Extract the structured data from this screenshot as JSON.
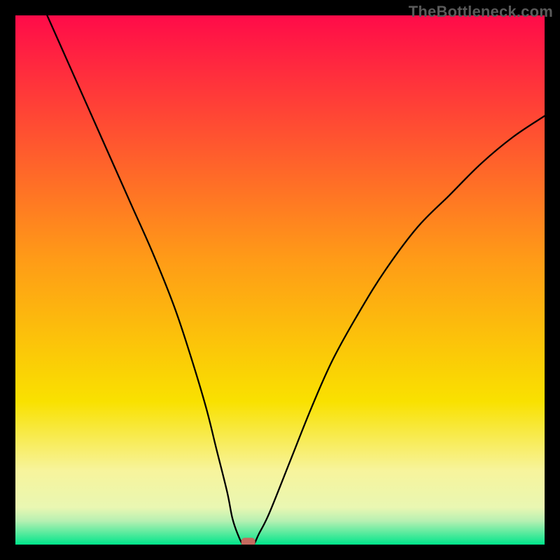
{
  "watermark": "TheBottleneck.com",
  "chart_data": {
    "type": "line",
    "title": "",
    "xlabel": "",
    "ylabel": "",
    "xlim": [
      0,
      100
    ],
    "ylim": [
      0,
      100
    ],
    "grid": false,
    "background_gradient": [
      {
        "stop": 0.0,
        "color": "#ff0b49"
      },
      {
        "stop": 0.46,
        "color": "#ff9b17"
      },
      {
        "stop": 0.73,
        "color": "#f9e100"
      },
      {
        "stop": 0.86,
        "color": "#f7f49c"
      },
      {
        "stop": 0.93,
        "color": "#e9f7b2"
      },
      {
        "stop": 0.955,
        "color": "#b7f0b2"
      },
      {
        "stop": 1.0,
        "color": "#00e58b"
      }
    ],
    "series": [
      {
        "name": "bottleneck-curve",
        "x": [
          6,
          10,
          14,
          18,
          22,
          26,
          30,
          33,
          36,
          38,
          40,
          41,
          42,
          43,
          44,
          45,
          46,
          48,
          52,
          56,
          60,
          65,
          70,
          76,
          82,
          88,
          94,
          100
        ],
        "values": [
          100,
          91,
          82,
          73,
          64,
          55,
          45,
          36,
          26,
          18,
          10,
          5,
          2,
          0,
          0,
          0,
          2,
          6,
          16,
          26,
          35,
          44,
          52,
          60,
          66,
          72,
          77,
          81
        ]
      }
    ],
    "marker": {
      "x": 44,
      "y": 0.5,
      "color": "#c46a5f"
    }
  }
}
